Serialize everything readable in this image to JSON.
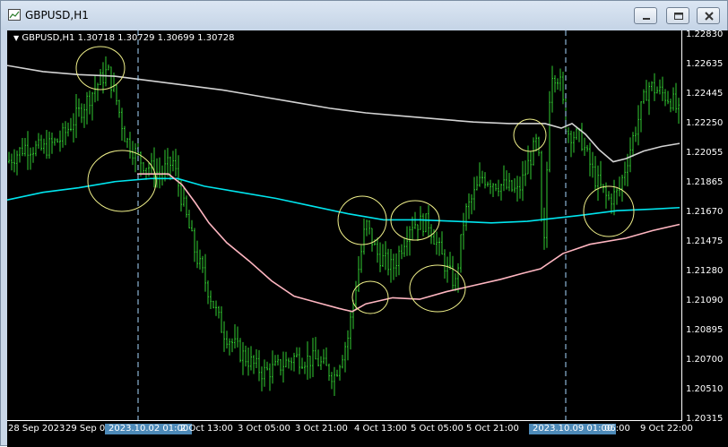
{
  "window": {
    "title": "GBPUSD,H1"
  },
  "window_controls": {
    "minimize": "minimize",
    "maximize": "maximize",
    "close": "close"
  },
  "chart": {
    "symbol_info": "GBPUSD,H1  1.30718 1.30729 1.30699 1.30728",
    "price_labels": [
      "1.22830",
      "1.22635",
      "1.22445",
      "1.22250",
      "1.22055",
      "1.21865",
      "1.21670",
      "1.21475",
      "1.21280",
      "1.21090",
      "1.20895",
      "1.20700",
      "1.20510",
      "1.20315"
    ],
    "time_labels": [
      {
        "text": "28 Sep 2023",
        "hl": false
      },
      {
        "text": "29 Sep 04:00",
        "hl": false
      },
      {
        "text": "2023.10.02 01:00",
        "hl": true
      },
      {
        "text": "2 Oct 13:00",
        "hl": false
      },
      {
        "text": "3 Oct 05:00",
        "hl": false
      },
      {
        "text": "3 Oct 21:00",
        "hl": false
      },
      {
        "text": "4 Oct 13:00",
        "hl": false
      },
      {
        "text": "5 Oct 05:00",
        "hl": false
      },
      {
        "text": "5 Oct 21:00",
        "hl": false
      },
      {
        "text": "2023.10.09 01:00",
        "hl": true
      },
      {
        "text": "06:00",
        "hl": false
      },
      {
        "text": "9 Oct 22:00",
        "hl": false
      }
    ],
    "colors": {
      "background": "#000000",
      "candles": "#32cd32",
      "ma_slow": "#d3d3d3",
      "ma_mid": "#00e5ee",
      "ma_fast": "#ffb6c1",
      "circles": "#f0f08a",
      "separator": "#a8d8ff"
    }
  }
}
